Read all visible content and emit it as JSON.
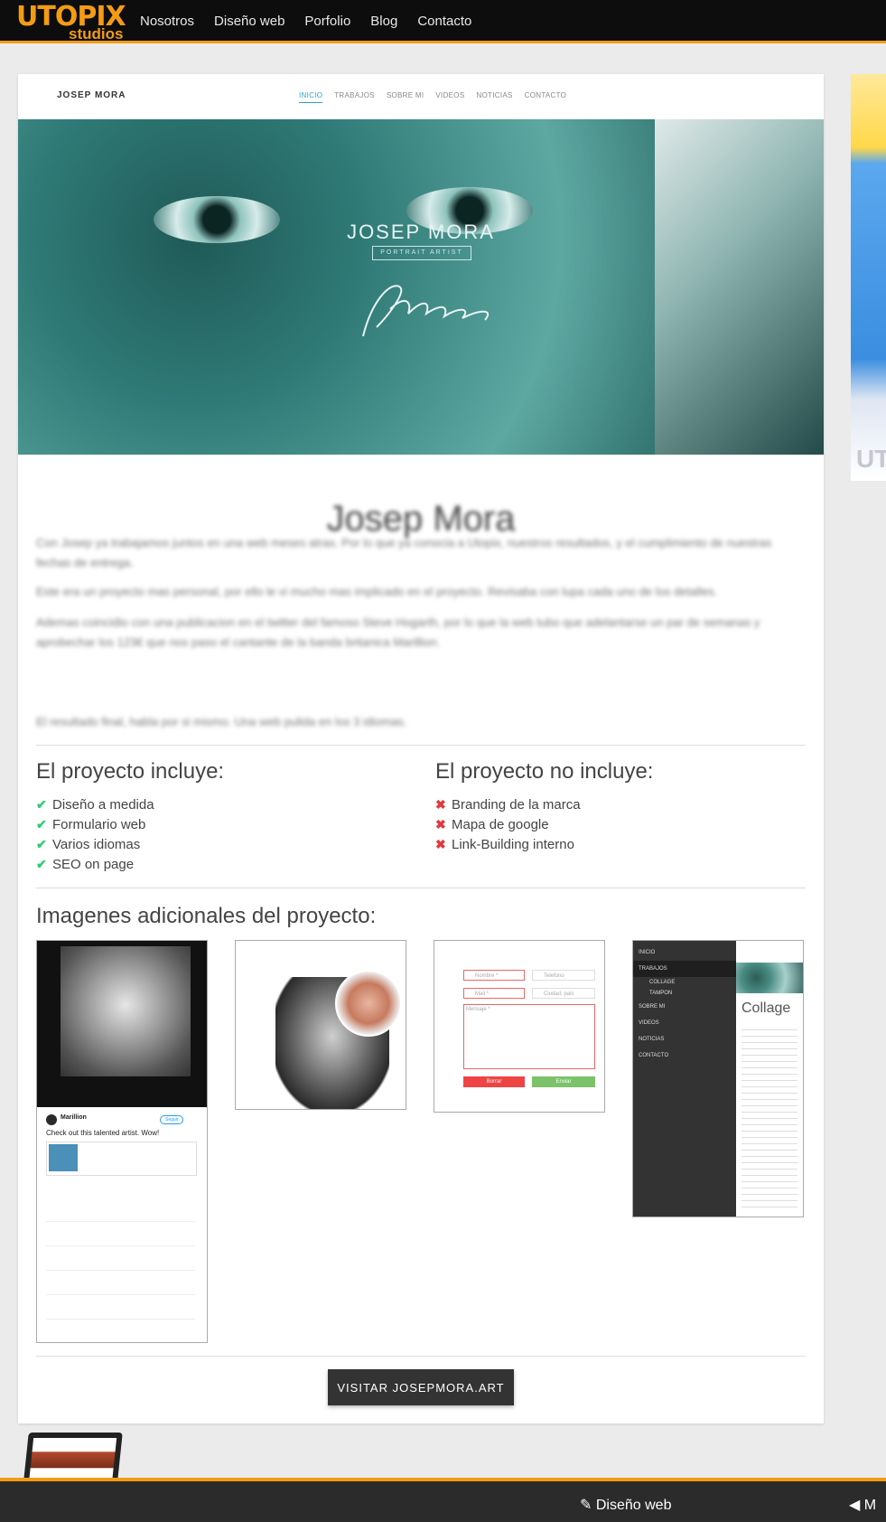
{
  "topbar": {
    "logo_main": "UTOPIX",
    "logo_sub": "studios",
    "nav": [
      "Nosotros",
      "Diseño web",
      "Porfolio",
      "Blog",
      "Contacto"
    ]
  },
  "site": {
    "brand": "JOSEP MORA",
    "nav": [
      "INICIO",
      "TRABAJOS",
      "SOBRE MI",
      "VIDEOS",
      "NOTICIAS",
      "CONTACTO"
    ],
    "hero_title": "JOSEP MORA",
    "hero_subtitle": "PORTRAIT ARTIST"
  },
  "project": {
    "title": "Josep Mora",
    "paragraphs": [
      "Con Josep ya trabajamos juntos en una web meses atras. Por lo que ya conocia a Utopix, nuestros resultados, y el cumplimiento de nuestras fechas de entrega.",
      "Este era un proyecto mas personal, por ello le vi mucho mas implicado en el proyecto. Revisaba con lupa cada uno de los detalles.",
      "Ademas coincidio con una publicacion en el twitter del famoso Steve Hogarth, por lo que la web tubo que adelantarse un par de semanas y aprobechar los 123€ que nos paso el cantante de la banda britanica Marillion.",
      "El resultado final, habla por si mismo. Una web pulida en los 3 idiomas."
    ],
    "includes_title": "El proyecto incluye:",
    "includes": [
      "Diseño a medida",
      "Formulario web",
      "Varios idiomas",
      "SEO on page"
    ],
    "excludes_title": "El proyecto no incluye:",
    "excludes": [
      "Branding de la marca",
      "Mapa de google",
      "Link-Building interno"
    ],
    "images_title": "Imagenes adicionales del proyecto:",
    "cta_label": "VISITAR JOSEPMORA.ART"
  },
  "thumb_tweet": {
    "account": "Marillion",
    "follow": "Seguir",
    "text": "Check out this talented artist. Wow!"
  },
  "thumb_form": {
    "name": "Nombre *",
    "phone": "Telefono",
    "mail": "Mail *",
    "country": "Ciudad, pais",
    "message": "Mensaje *",
    "delete": "Borrar",
    "send": "Enviar"
  },
  "thumb_menu": {
    "items": [
      "INICIO",
      "TRABAJOS",
      "COLLAGE",
      "TAMPON",
      "SOBRE MI",
      "VIDEOS",
      "NOTICIAS",
      "CONTACTO"
    ],
    "heading": "Collage"
  },
  "footer": {
    "link1": "Diseño web",
    "link2": "M"
  },
  "colors": {
    "accent": "#f39c12",
    "ok": "#2ecc71",
    "no": "#e0393e",
    "site_active": "#22a7c8"
  }
}
